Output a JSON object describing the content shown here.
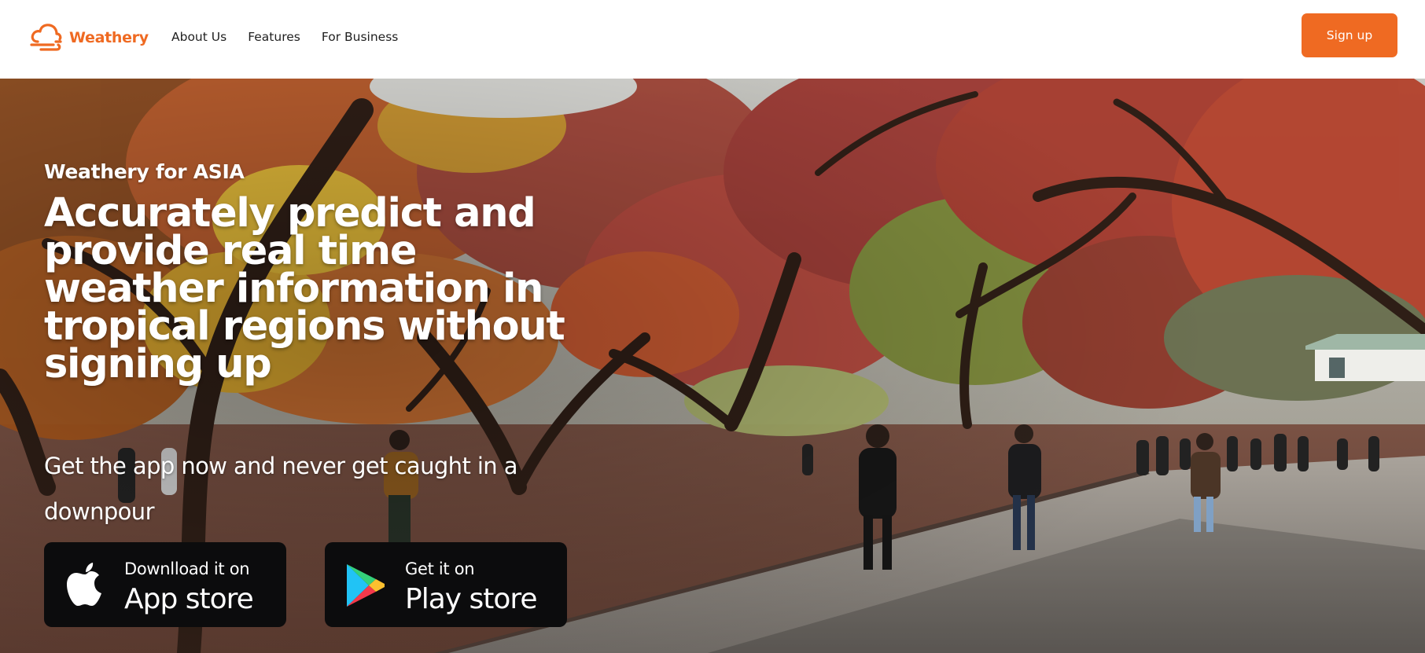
{
  "header": {
    "brand_name": "Weathery",
    "nav": [
      {
        "label": "About Us"
      },
      {
        "label": "Features"
      },
      {
        "label": "For Business"
      }
    ],
    "signup_label": "Sign up"
  },
  "hero": {
    "eyebrow": "Weathery for ASIA",
    "headline": "Accurately predict and provide real time weather information in tropical regions without signing up",
    "tagline": "Get the app now and never get caught in a downpour",
    "app_store": {
      "small": "Downlload it on",
      "big": "App store",
      "icon": "apple-icon"
    },
    "play_store": {
      "small": "Get it on",
      "big": "Play store",
      "icon": "google-play-icon"
    }
  },
  "colors": {
    "brand": "#ef6a22",
    "nav_text": "#1f1f1f",
    "store_button": "#0c0c0d"
  }
}
